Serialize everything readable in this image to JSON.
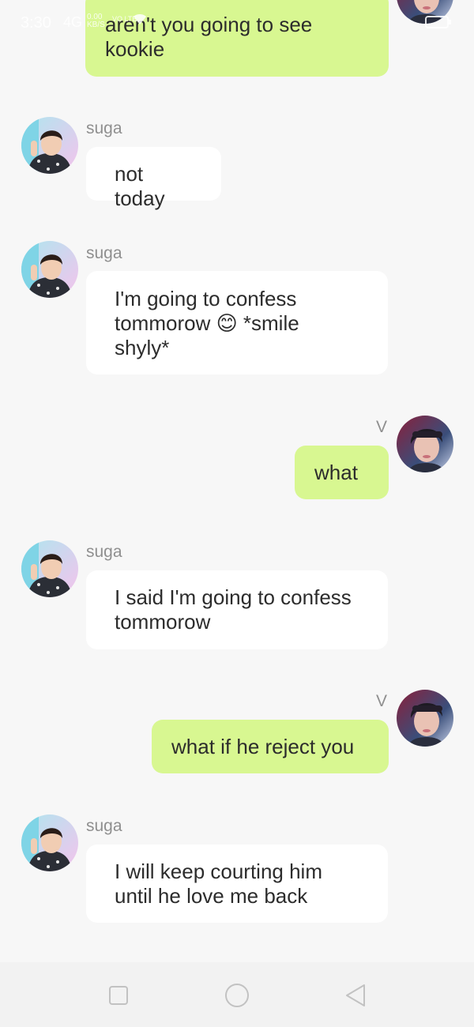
{
  "status_bar": {
    "time": "3:30",
    "network": "4G",
    "speed_value": "0.00",
    "speed_unit": "KB/S",
    "volte": "VO LTE"
  },
  "conversation": {
    "messages": [
      {
        "sender": "V",
        "side": "right",
        "text": "aren't you going to see kookie"
      },
      {
        "sender": "suga",
        "side": "left",
        "text": "not today"
      },
      {
        "sender": "suga",
        "side": "left",
        "text": "I'm going to confess tommorow 😊 *smile shyly*"
      },
      {
        "sender": "V",
        "side": "right",
        "text": "what"
      },
      {
        "sender": "suga",
        "side": "left",
        "text": "I said I'm going to confess tommorow"
      },
      {
        "sender": "V",
        "side": "right",
        "text": "what if he reject you"
      },
      {
        "sender": "suga",
        "side": "left",
        "text": "I will keep courting him until he love me back"
      }
    ]
  },
  "colors": {
    "sent_bubble": "#d8f791",
    "received_bubble": "#ffffff",
    "background": "#f7f7f7",
    "sender_name": "#8f8f8f"
  },
  "nav_bar": {
    "icons": [
      "recent-apps-icon",
      "home-icon",
      "back-icon"
    ]
  }
}
